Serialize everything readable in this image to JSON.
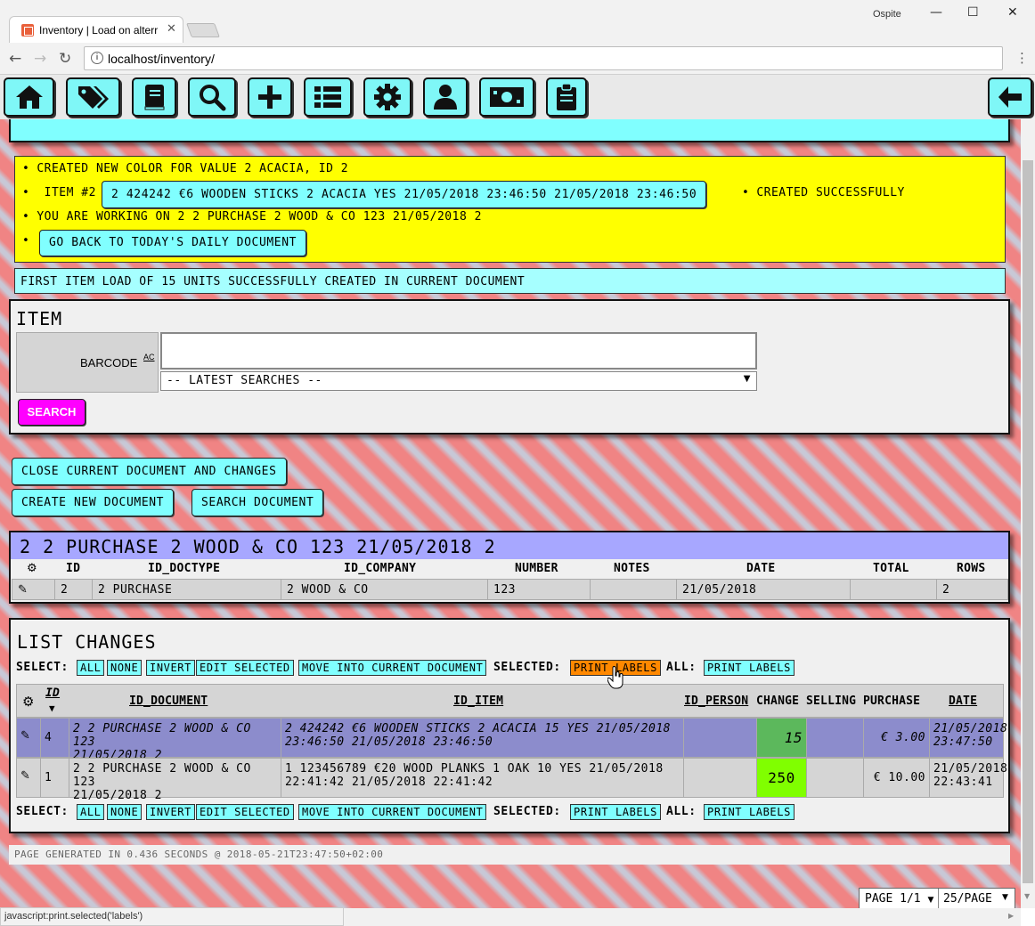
{
  "browser": {
    "tab_title": "Inventory | Load on alterr",
    "profile": "Ospite",
    "url": "localhost/inventory/",
    "status_text": "javascript:print.selected('labels')"
  },
  "toolbar": {
    "icons": [
      "home-icon",
      "tags-icon",
      "book-icon",
      "search-icon",
      "plus-icon",
      "list-icon",
      "gear-icon",
      "user-icon",
      "money-icon",
      "clipboard-icon",
      "back-arrow-icon"
    ]
  },
  "page": {
    "title": "LOAD ON ALTERNATE DOCUMENT",
    "messages": {
      "m1": "CREATED NEW COLOR FOR VALUE 2 ACACIA, ID 2",
      "m2_prefix": "ITEM #2",
      "m2_button": "2 424242 €6 WOODEN STICKS 2 ACACIA YES 21/05/2018 23:46:50 21/05/2018 23:46:50",
      "m2_suffix": "CREATED SUCCESSFULLY",
      "m3": "YOU ARE WORKING ON 2 2 PURCHASE 2 WOOD & CO 123 21/05/2018 2",
      "m4_button": "GO BACK TO TODAY'S DAILY DOCUMENT"
    },
    "info": "FIRST ITEM LOAD OF 15 UNITS SUCCESSFULLY CREATED IN CURRENT DOCUMENT"
  },
  "item": {
    "heading": "ITEM",
    "barcode_label": "BARCODE",
    "barcode_sup": "AC",
    "barcode_value": "",
    "latest_searches": "-- LATEST SEARCHES --",
    "search_button": "SEARCH"
  },
  "actions": {
    "close_doc": "CLOSE CURRENT DOCUMENT AND CHANGES",
    "create_doc": "CREATE NEW DOCUMENT",
    "search_doc": "SEARCH DOCUMENT"
  },
  "document": {
    "title": "2 2 PURCHASE 2 WOOD & CO 123 21/05/2018 2",
    "headers": [
      "ID",
      "ID_DOCTYPE",
      "ID_COMPANY",
      "NUMBER",
      "NOTES",
      "DATE",
      "TOTAL",
      "ROWS"
    ],
    "row": {
      "id": "2",
      "doctype": "2 PURCHASE",
      "company": "2 WOOD & CO",
      "number": "123",
      "notes": "",
      "date": "21/05/2018",
      "total": "",
      "rows": "2"
    }
  },
  "changes": {
    "heading": "LIST CHANGES",
    "select_label": "SELECT:",
    "select_buttons": [
      "ALL",
      "NONE",
      "INVERT",
      "EDIT SELECTED",
      "MOVE INTO CURRENT DOCUMENT"
    ],
    "selected_label": "SELECTED:",
    "selected_button": "PRINT LABELS",
    "all_label": "ALL:",
    "all_button": "PRINT LABELS",
    "headers": {
      "id": "ID",
      "sort": "▼",
      "id_document": "ID_DOCUMENT",
      "id_item": "ID_ITEM",
      "id_person": "ID_PERSON",
      "change": "CHANGE",
      "selling": "SELLING",
      "purchase": "PURCHASE",
      "date": "DATE"
    },
    "rows": [
      {
        "id": "4",
        "doc1": "2 2 PURCHASE 2 WOOD & CO 123",
        "doc2": "21/05/2018 2",
        "item1": "2 424242 €6 WOODEN STICKS 2 ACACIA 15 YES 21/05/2018",
        "item2": "23:46:50 21/05/2018 23:46:50",
        "person": "",
        "change": "15",
        "selling": "",
        "purchase": "€ 3.00",
        "date1": "21/05/2018",
        "date2": "23:47:50"
      },
      {
        "id": "1",
        "doc1": "2 2 PURCHASE 2 WOOD & CO 123",
        "doc2": "21/05/2018 2",
        "item1": "1 123456789 €20 WOOD PLANKS 1 OAK 10 YES 21/05/2018",
        "item2": "22:41:42 21/05/2018 22:41:42",
        "person": "",
        "change": "250",
        "selling": "",
        "purchase": "€ 10.00",
        "date1": "21/05/2018",
        "date2": "22:43:41"
      }
    ]
  },
  "footer": {
    "generated": "PAGE GENERATED IN 0.436 SECONDS @ 2018-05-21T23:47:50+02:00",
    "page_select": "PAGE 1/1",
    "per_page": "25/PAGE"
  },
  "colors": {
    "cyan": "#80ffff",
    "yellow": "#ffff00",
    "magenta": "#ff00ff",
    "lavender": "#a7a7ff",
    "orange": "#ff8800",
    "selected_row": "#8c8ccc",
    "change_green": "#5cb85c",
    "change_lime": "#80ff00"
  }
}
